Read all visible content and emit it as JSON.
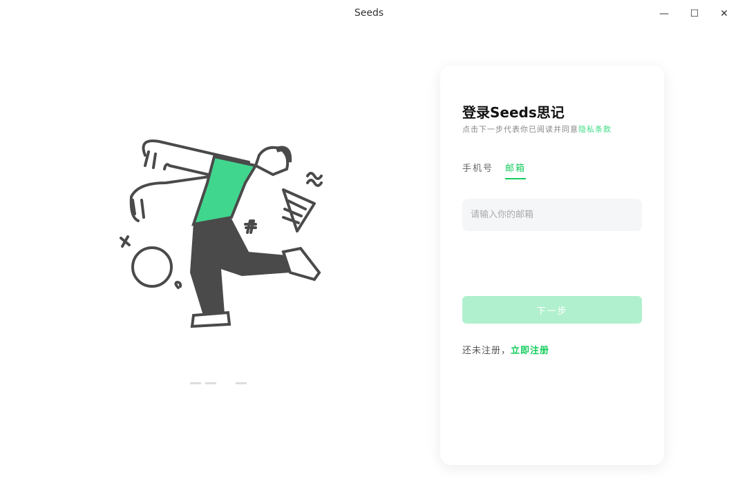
{
  "window": {
    "title": "Seeds",
    "minimize": "—",
    "maximize": "☐",
    "close": "✕"
  },
  "login": {
    "heading": "登录Seeds思记",
    "subtitle": "点击下一步代表你已阅读并同意",
    "privacy_link": "隐私条款",
    "tabs": [
      {
        "label": "手机号"
      },
      {
        "label": "邮箱"
      }
    ],
    "email_placeholder": "请输入你的邮箱",
    "next_button": "下一步",
    "no_account": "还未注册，",
    "register_link": "立即注册"
  },
  "carousel": {
    "count": 4,
    "active": 2
  },
  "colors": {
    "accent": "#14cc5c",
    "shirt": "#41d68e",
    "disabled_button": "#b1f0ce"
  }
}
